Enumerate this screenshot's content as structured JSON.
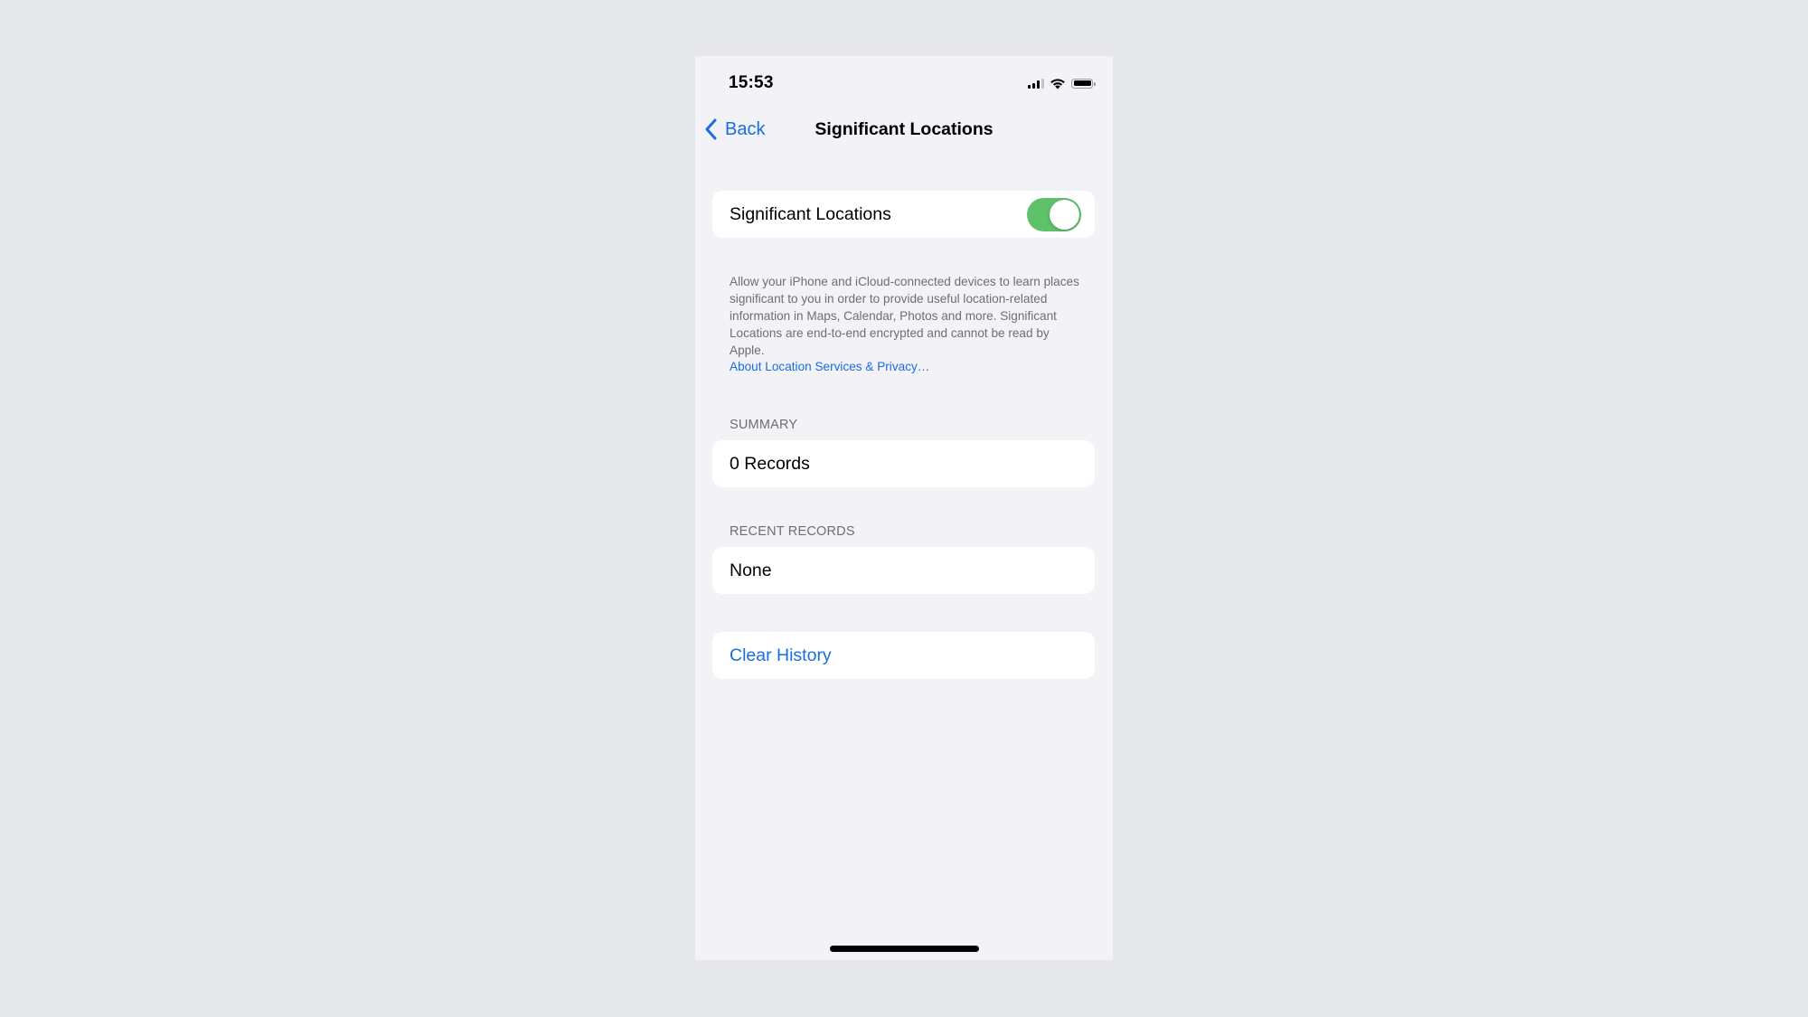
{
  "status_bar": {
    "time": "15:53",
    "icons": [
      "cellular-signal-icon",
      "wifi-icon",
      "battery-icon"
    ],
    "signal_bars_active": 3,
    "signal_bars_total": 4,
    "battery_level": 1.0
  },
  "nav": {
    "back_label": "Back",
    "back_icon": "chevron-left-icon",
    "title": "Significant Locations"
  },
  "toggle_row": {
    "label": "Significant Locations",
    "enabled": true
  },
  "footer": {
    "text": "Allow your iPhone and iCloud-connected devices to learn places significant to you in order to provide useful location-related information in Maps, Calendar, Photos and more. Significant Locations are end-to-end encrypted and cannot be read by Apple.",
    "link": "About Location Services & Privacy…"
  },
  "summary": {
    "header": "SUMMARY",
    "value": "0 Records"
  },
  "recent_records": {
    "header": "RECENT RECORDS",
    "value": "None"
  },
  "actions": {
    "clear_history": "Clear History"
  },
  "colors": {
    "accent": "#1a6de0",
    "toggle_on": "#5ec26a",
    "grouped_background": "#f2f2f7",
    "secondary_text": "#6e6e73"
  }
}
